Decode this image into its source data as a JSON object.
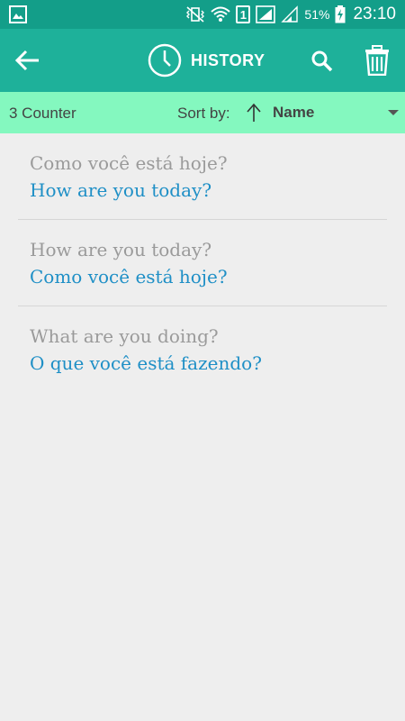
{
  "status_bar": {
    "battery_percent": "51%",
    "time": "23:10",
    "sim_slot": "1"
  },
  "app_bar": {
    "title": "HISTORY",
    "icons": [
      "back-arrow-icon",
      "clock-icon",
      "search-icon",
      "trash-icon"
    ]
  },
  "sort_bar": {
    "counter": "3 Counter",
    "sort_by_label": "Sort by:",
    "sort_value": "Name",
    "sort_direction": "ascending"
  },
  "history": [
    {
      "source": "Como você está hoje?",
      "translation": "How are you today?"
    },
    {
      "source": "How are you today?",
      "translation": "Como você está hoje?"
    },
    {
      "source": "What are you doing?",
      "translation": "O que você está fazendo?"
    }
  ],
  "colors": {
    "status_bar": "#139e89",
    "app_bar": "#1eb19a",
    "sort_bar": "#84f8bf",
    "source_text": "#9a9a9a",
    "translation_text": "#1e8fc6",
    "background": "#eeeeee"
  }
}
